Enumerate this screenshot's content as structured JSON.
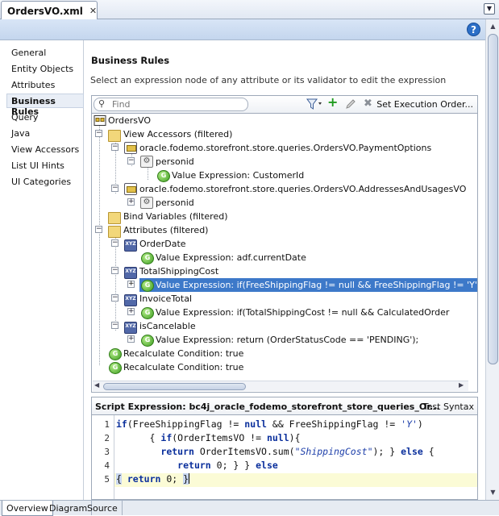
{
  "editor_tab": {
    "title": "OrdersVO.xml"
  },
  "nav": {
    "items": [
      "General",
      "Entity Objects",
      "Attributes",
      "Business Rules",
      "Query",
      "Java",
      "View Accessors",
      "List UI Hints",
      "UI Categories"
    ],
    "active_index": 3
  },
  "section": {
    "title": "Business Rules",
    "description": "Select an expression node of any attribute or its validator to edit the expression"
  },
  "toolbar": {
    "find_placeholder": "Find",
    "set_execution_label": "Set Execution Order..."
  },
  "tree": {
    "rows": [
      {
        "label": "OrdersVO",
        "icon": "vo-icon"
      },
      {
        "label": "View Accessors (filtered)",
        "icon": "folder-icon"
      },
      {
        "label": "oracle.fodemo.storefront.store.queries.OrdersVO.PaymentOptions",
        "icon": "view-accessor-icon"
      },
      {
        "label": "personid",
        "icon": "gear-icon"
      },
      {
        "label": "Value Expression: CustomerId",
        "icon": "expression-icon"
      },
      {
        "label": "oracle.fodemo.storefront.store.queries.OrdersVO.AddressesAndUsagesVO",
        "icon": "view-accessor-icon"
      },
      {
        "label": "personid",
        "icon": "gear-icon"
      },
      {
        "label": "Bind Variables (filtered)",
        "icon": "folder-icon"
      },
      {
        "label": "Attributes (filtered)",
        "icon": "folder-icon"
      },
      {
        "label": "OrderDate",
        "icon": "attribute-icon"
      },
      {
        "label": "Value Expression: adf.currentDate",
        "icon": "expression-icon"
      },
      {
        "label": "TotalShippingCost",
        "icon": "attribute-icon"
      },
      {
        "label": "Value Expression: if(FreeShippingFlag != null && FreeShippingFlag != 'Y')      { if(Or",
        "icon": "expression-icon"
      },
      {
        "label": "InvoiceTotal",
        "icon": "attribute-icon"
      },
      {
        "label": "Value Expression: if(TotalShippingCost != null &&                    CalculatedOrder",
        "icon": "expression-icon"
      },
      {
        "label": "isCancelable",
        "icon": "attribute-icon"
      },
      {
        "label": "Value Expression: return (OrderStatusCode == 'PENDING');",
        "icon": "expression-icon"
      },
      {
        "label": "Recalculate Condition: true",
        "icon": "expression-icon"
      },
      {
        "label": "Recalculate Condition: true",
        "icon": "expression-icon"
      }
    ],
    "selected_index": 12
  },
  "script": {
    "title": "Script Expression: bc4j_oracle_fodemo_storefront_store_queries_Or...",
    "test_syntax_label": "Test Syntax",
    "line_numbers": [
      "1",
      "2",
      "3",
      "4",
      "5"
    ],
    "current_line": 5
  },
  "bottom_tabs": [
    "Overview",
    "Diagram",
    "Source"
  ],
  "active_bottom_tab": 0
}
